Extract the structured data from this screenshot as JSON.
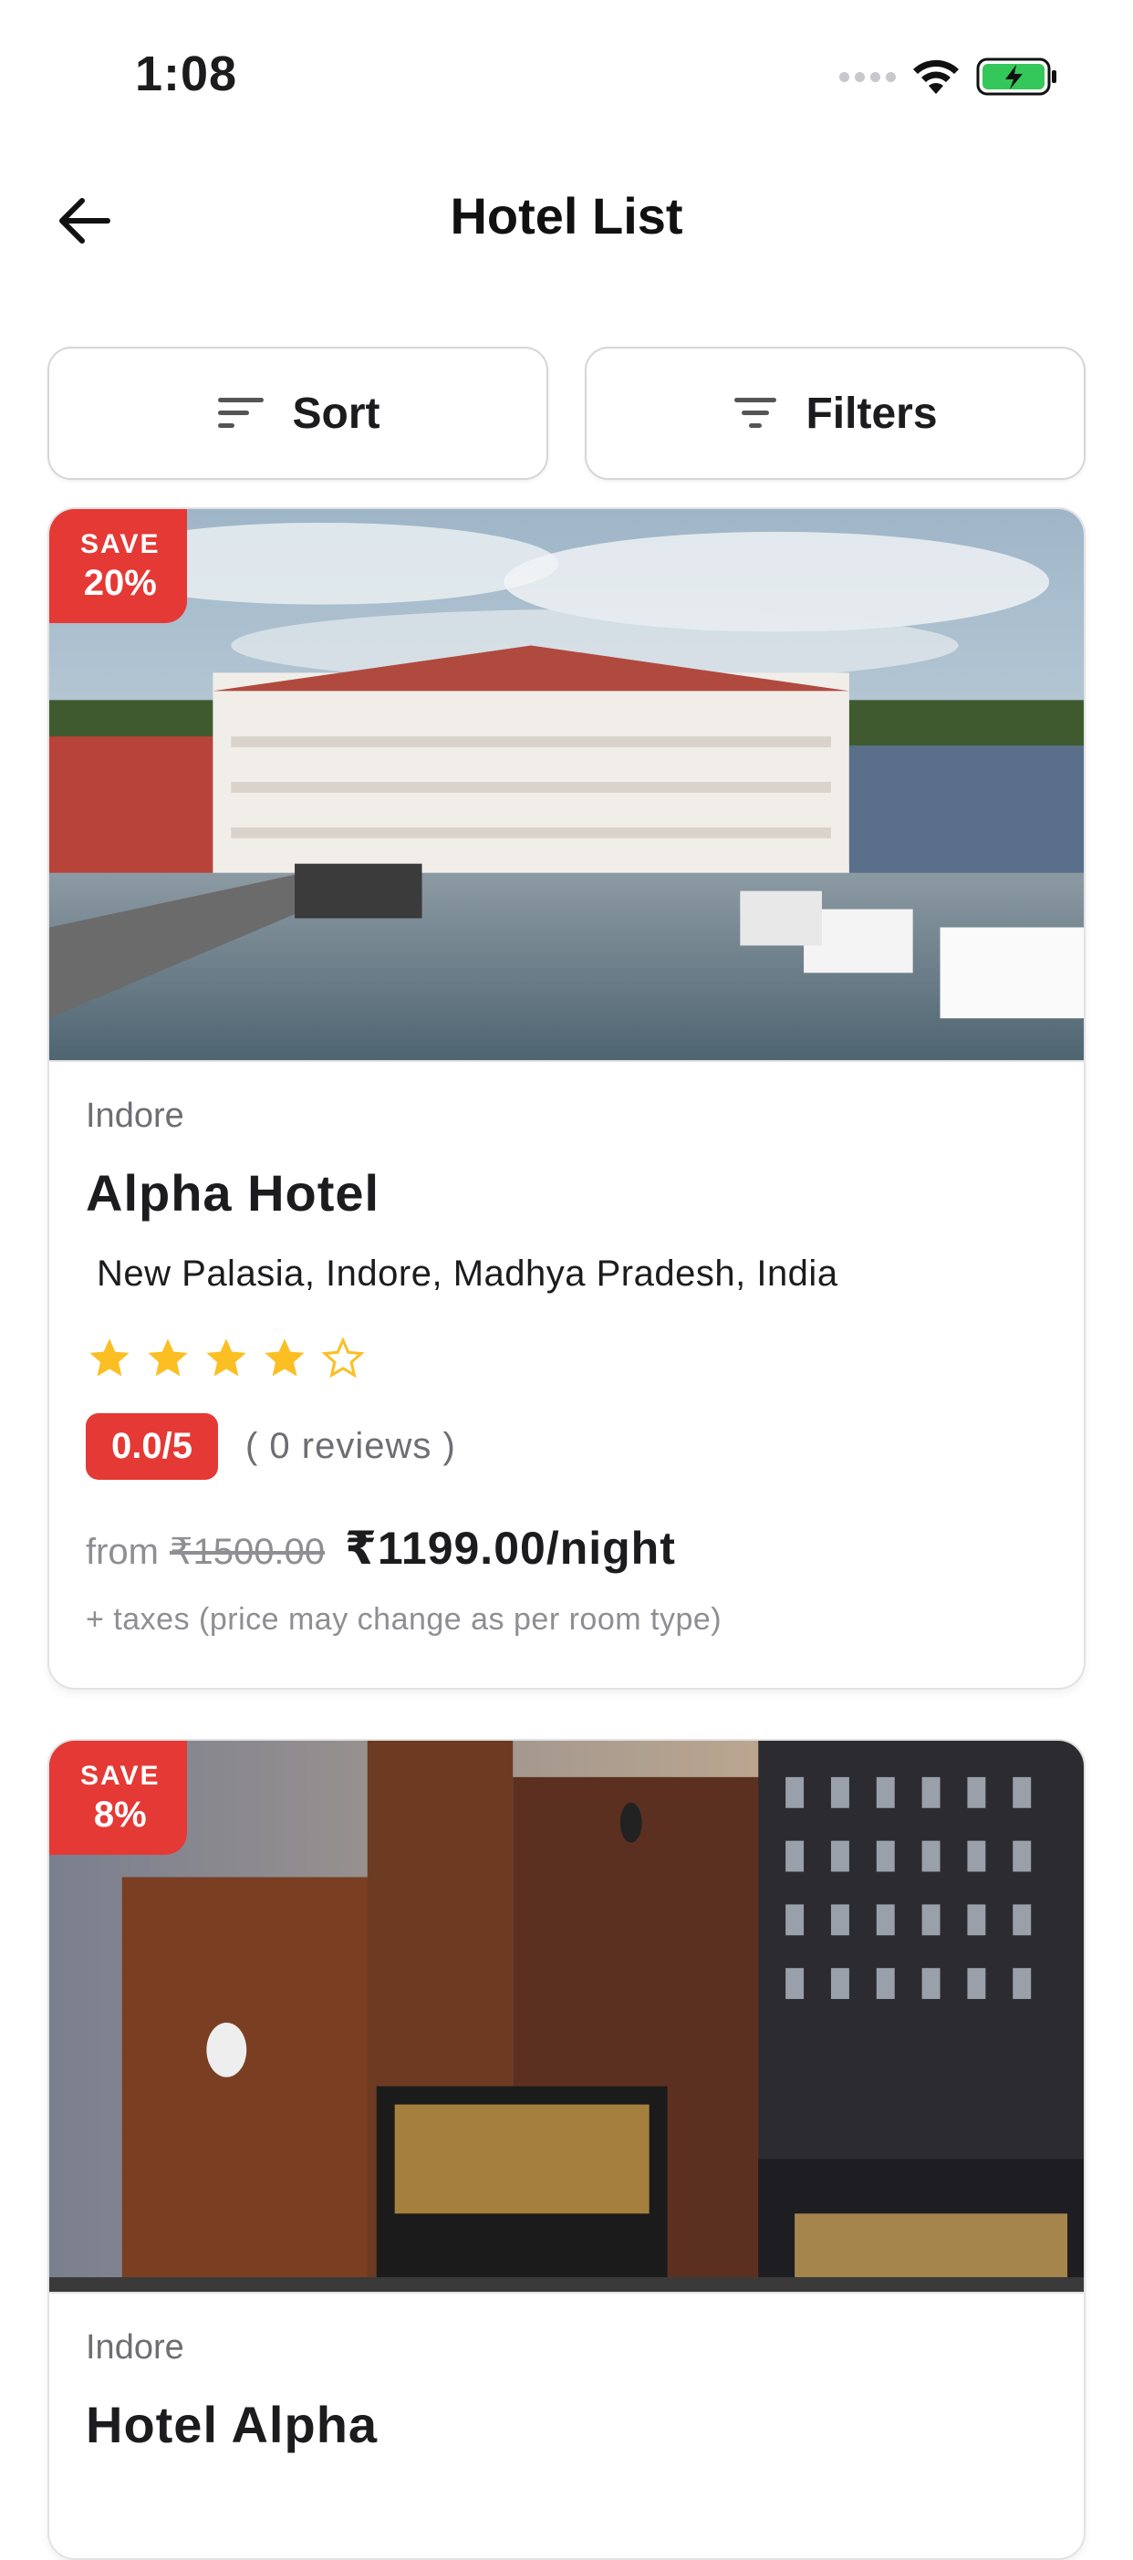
{
  "status_bar": {
    "time": "1:08",
    "signal_icon": "signal-dots-icon",
    "wifi_icon": "wifi-icon",
    "battery_icon": "battery-charging-icon",
    "battery_color": "#34c759"
  },
  "header": {
    "back_icon": "arrow-left-icon",
    "title": "Hotel List"
  },
  "controls": {
    "sort_label": "Sort",
    "filters_label": "Filters"
  },
  "colors": {
    "accent": "#e53935",
    "star": "#fbbf24"
  },
  "hotels": [
    {
      "save_label": "SAVE",
      "save_value": "20%",
      "city": "Indore",
      "name": "Alpha Hotel",
      "address": "New Palasia, Indore, Madhya Pradesh, India",
      "stars_filled": 4,
      "stars_total": 5,
      "rating": "0.0/5",
      "reviews": "( 0 reviews )",
      "price_prefix": "from",
      "price_old": "₹1500.00",
      "price_new": "₹1199.00/night",
      "taxes_note": "+ taxes (price may change as per room type)"
    },
    {
      "save_label": "SAVE",
      "save_value": "8%",
      "city": "Indore",
      "name": "Hotel Alpha"
    }
  ]
}
